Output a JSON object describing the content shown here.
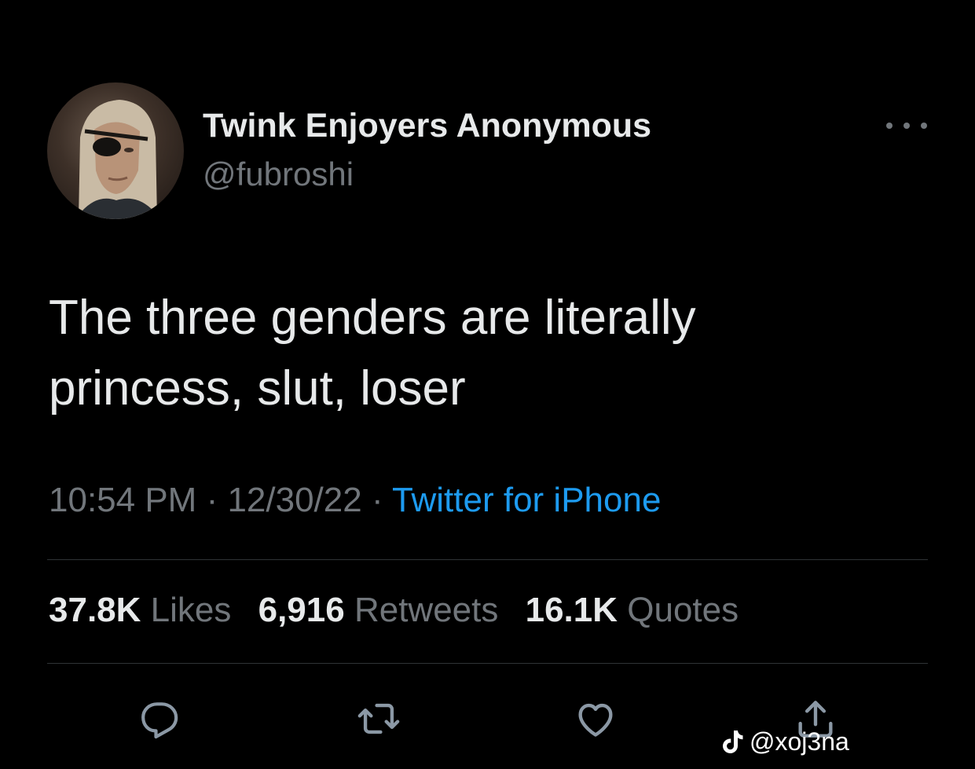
{
  "author": {
    "display_name": "Twink Enjoyers Anonymous",
    "handle": "@fubroshi"
  },
  "tweet": {
    "text_line1": "The three genders are literally",
    "text_line2": "princess, slut, loser",
    "time": "10:54 PM",
    "date": "12/30/22",
    "separator": " · ",
    "source": "Twitter for iPhone"
  },
  "stats": {
    "likes_count": "37.8K",
    "likes_label": "Likes",
    "retweets_count": "6,916",
    "retweets_label": "Retweets",
    "quotes_count": "16.1K",
    "quotes_label": "Quotes"
  },
  "actions": [
    "reply-icon",
    "retweet-icon",
    "like-icon",
    "share-icon"
  ],
  "watermark": {
    "handle": "@xoj3na",
    "icon": "tiktok-icon"
  },
  "colors": {
    "background": "#000000",
    "primary_text": "#e7e9ea",
    "secondary_text": "#71767b",
    "accent": "#1d9bf0",
    "divider": "#2f3336"
  }
}
